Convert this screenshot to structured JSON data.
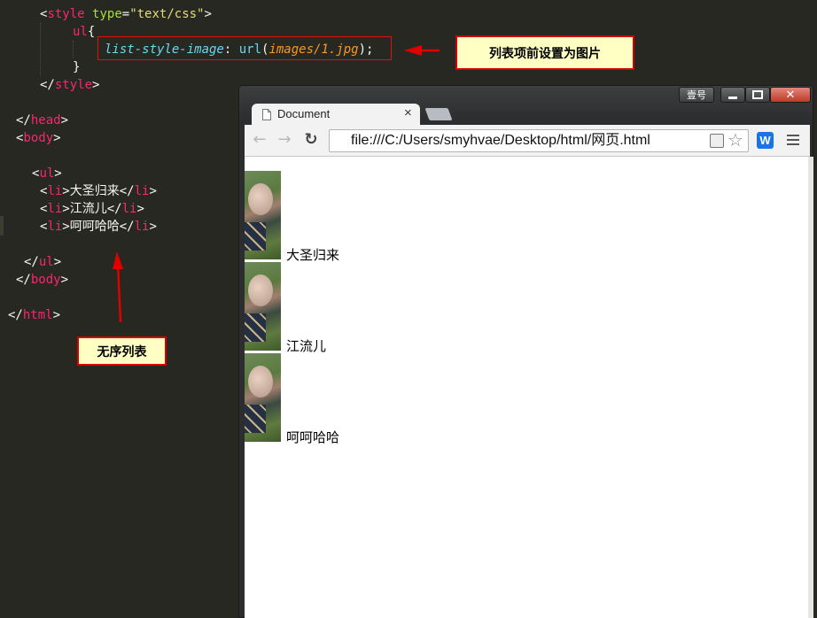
{
  "editor": {
    "lines": [
      {
        "id": "l1",
        "parts": [
          [
            "punc",
            "<"
          ],
          [
            "tag",
            "style"
          ],
          [
            "punc",
            " "
          ],
          [
            "attr",
            "type"
          ],
          [
            "punc",
            "="
          ],
          [
            "str",
            "\"text/css\""
          ],
          [
            "punc",
            ">"
          ]
        ]
      },
      {
        "id": "l2",
        "parts": [
          [
            "tag",
            "ul"
          ],
          [
            "punc",
            "{"
          ]
        ]
      },
      {
        "id": "l3",
        "parts": [
          [
            "prop",
            "list-style-image"
          ],
          [
            "punc",
            ": "
          ],
          [
            "fn",
            "url"
          ],
          [
            "punc",
            "("
          ],
          [
            "arg",
            "images/1.jpg"
          ],
          [
            "punc",
            ");"
          ]
        ]
      },
      {
        "id": "l4",
        "parts": [
          [
            "punc",
            "}"
          ]
        ]
      },
      {
        "id": "l5",
        "parts": [
          [
            "punc",
            "</"
          ],
          [
            "tag",
            "style"
          ],
          [
            "punc",
            ">"
          ]
        ]
      },
      {
        "id": "l6",
        "parts": [
          [
            "punc",
            "</"
          ],
          [
            "tag",
            "head"
          ],
          [
            "punc",
            ">"
          ]
        ]
      },
      {
        "id": "l7",
        "parts": [
          [
            "punc",
            "<"
          ],
          [
            "tag",
            "body"
          ],
          [
            "punc",
            ">"
          ]
        ]
      },
      {
        "id": "l8",
        "parts": [
          [
            "punc",
            "<"
          ],
          [
            "tag",
            "ul"
          ],
          [
            "punc",
            ">"
          ]
        ]
      },
      {
        "id": "l9",
        "parts": [
          [
            "punc",
            "<"
          ],
          [
            "tag",
            "li"
          ],
          [
            "punc",
            ">"
          ],
          [
            "txt",
            "大圣归来"
          ],
          [
            "punc",
            "</"
          ],
          [
            "tag",
            "li"
          ],
          [
            "punc",
            ">"
          ]
        ]
      },
      {
        "id": "l10",
        "parts": [
          [
            "punc",
            "<"
          ],
          [
            "tag",
            "li"
          ],
          [
            "punc",
            ">"
          ],
          [
            "txt",
            "江流儿"
          ],
          [
            "punc",
            "</"
          ],
          [
            "tag",
            "li"
          ],
          [
            "punc",
            ">"
          ]
        ]
      },
      {
        "id": "l11",
        "parts": [
          [
            "punc",
            "<"
          ],
          [
            "tag",
            "li"
          ],
          [
            "punc",
            ">"
          ],
          [
            "txt",
            "呵呵哈哈"
          ],
          [
            "punc",
            "</"
          ],
          [
            "tag",
            "li"
          ],
          [
            "punc",
            ">"
          ]
        ]
      },
      {
        "id": "l12",
        "parts": [
          [
            "punc",
            "</"
          ],
          [
            "tag",
            "ul"
          ],
          [
            "punc",
            ">"
          ]
        ]
      },
      {
        "id": "l13",
        "parts": [
          [
            "punc",
            "</"
          ],
          [
            "tag",
            "body"
          ],
          [
            "punc",
            ">"
          ]
        ]
      },
      {
        "id": "l14",
        "parts": [
          [
            "punc",
            "</"
          ],
          [
            "tag",
            "html"
          ],
          [
            "punc",
            ">"
          ]
        ]
      }
    ]
  },
  "annotations": {
    "callout_image": "列表项前设置为图片",
    "callout_ul": "无序列表"
  },
  "browser": {
    "tab_title": "Document",
    "tab_close": "×",
    "user_badge": "壹号",
    "url": "file:///C:/Users/smyhvae/Desktop/html/网页.html",
    "list_items": [
      "大圣归来",
      "江流儿",
      "呵呵哈哈"
    ]
  },
  "colors": {
    "editor_bg": "#272822",
    "tag": "#f92672",
    "attribute": "#a6e22e",
    "string": "#e6db74",
    "property": "#66d9ef",
    "argument": "#fd971f",
    "annotation_red": "#d40000",
    "callout_bg": "#ffffc4"
  }
}
